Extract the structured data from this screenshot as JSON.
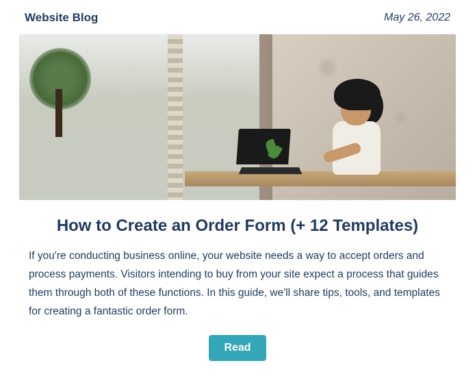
{
  "header": {
    "brand": "Website Blog",
    "date": "May 26, 2022"
  },
  "article": {
    "title": "How to Create an Order Form (+ 12 Templates)",
    "description": "If you're conducting business online, your website needs a way to accept orders and process payments. Visitors intending to buy from your site expect a process that guides them through both of these functions. In this guide, we'll share tips, tools, and templates for creating a fantastic order form.",
    "button_label": "Read"
  }
}
